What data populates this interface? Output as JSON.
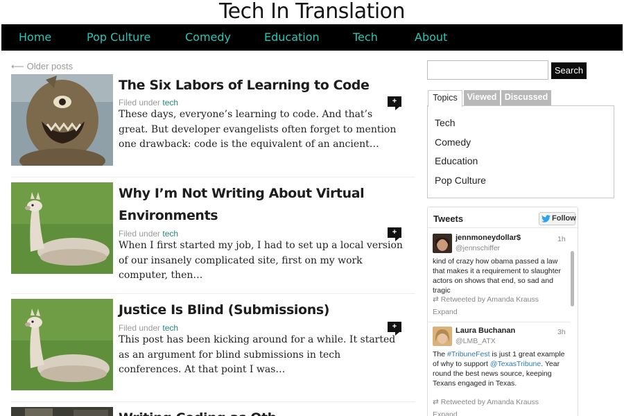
{
  "site": {
    "title": "Tech In Translation"
  },
  "nav": {
    "items": [
      {
        "label": "Home"
      },
      {
        "label": "Pop Culture"
      },
      {
        "label": "Comedy"
      },
      {
        "label": "Education"
      },
      {
        "label": "Tech"
      },
      {
        "label": "About"
      }
    ]
  },
  "older_posts": {
    "arrow": "⟵",
    "label": "Older posts"
  },
  "posts": [
    {
      "title": "The Six Labors of Learning to Code",
      "filed_prefix": "Filed under",
      "category": "tech",
      "excerpt": "These days, everyone’s learning to code. And that’s great. But developer evangelists often forget to mention one drawback: code is the equivalent of an ancient…",
      "comment_icon": "+"
    },
    {
      "title": "Why I’m Not Writing About Virtual Environments",
      "filed_prefix": "Filed under",
      "category": "tech",
      "excerpt": "When I first started my job, I had to set up a local version of our insanely complicated site, first on my work computer, then…",
      "comment_icon": "+"
    },
    {
      "title": "Justice Is Blind (Submissions)",
      "filed_prefix": "Filed under",
      "category": "tech",
      "excerpt": "This post has been kicking around for a while. It started as an argument for blind submissions in tech conferences. At that point I was…",
      "comment_icon": "+"
    },
    {
      "title": "Writing Coding as Oth"
    }
  ],
  "sidebar": {
    "search": {
      "value": "",
      "button_label": "Search"
    },
    "tabs": [
      {
        "label": "Topics"
      },
      {
        "label": "Viewed"
      },
      {
        "label": "Discussed"
      }
    ],
    "topics": [
      {
        "label": "Tech"
      },
      {
        "label": "Comedy"
      },
      {
        "label": "Education"
      },
      {
        "label": "Pop Culture"
      }
    ],
    "tweets": {
      "title": "Tweets",
      "follow_label": "Follow",
      "items": [
        {
          "name": "jennmoneydollar$",
          "handle": "@jennschiffer",
          "time": "1h",
          "text": "kind of crazy how obama passed a law that makes it a requirement to slaughter actors on shows that end, so sad and tragic",
          "retweet": "Retweeted by Amanda Krauss",
          "expand": "Expand"
        },
        {
          "name": "Laura Buchanan",
          "handle": "@LMB_ATX",
          "time": "3h",
          "text_parts": [
            "The ",
            "#TribuneFest",
            " is just 1 great example of why to support ",
            "@TexasTribune",
            ". Year round the best news source, keeping Texans engaged in Texas."
          ],
          "retweet": "Retweeted by Amanda Krauss",
          "expand": "Expand"
        }
      ]
    }
  },
  "colors": {
    "nav_bg": "#000000",
    "nav_link": "#27c6b7",
    "category_link": "#23887f",
    "tab_inactive": "#b8b8b8",
    "tweet_link": "#2b7bb9"
  }
}
